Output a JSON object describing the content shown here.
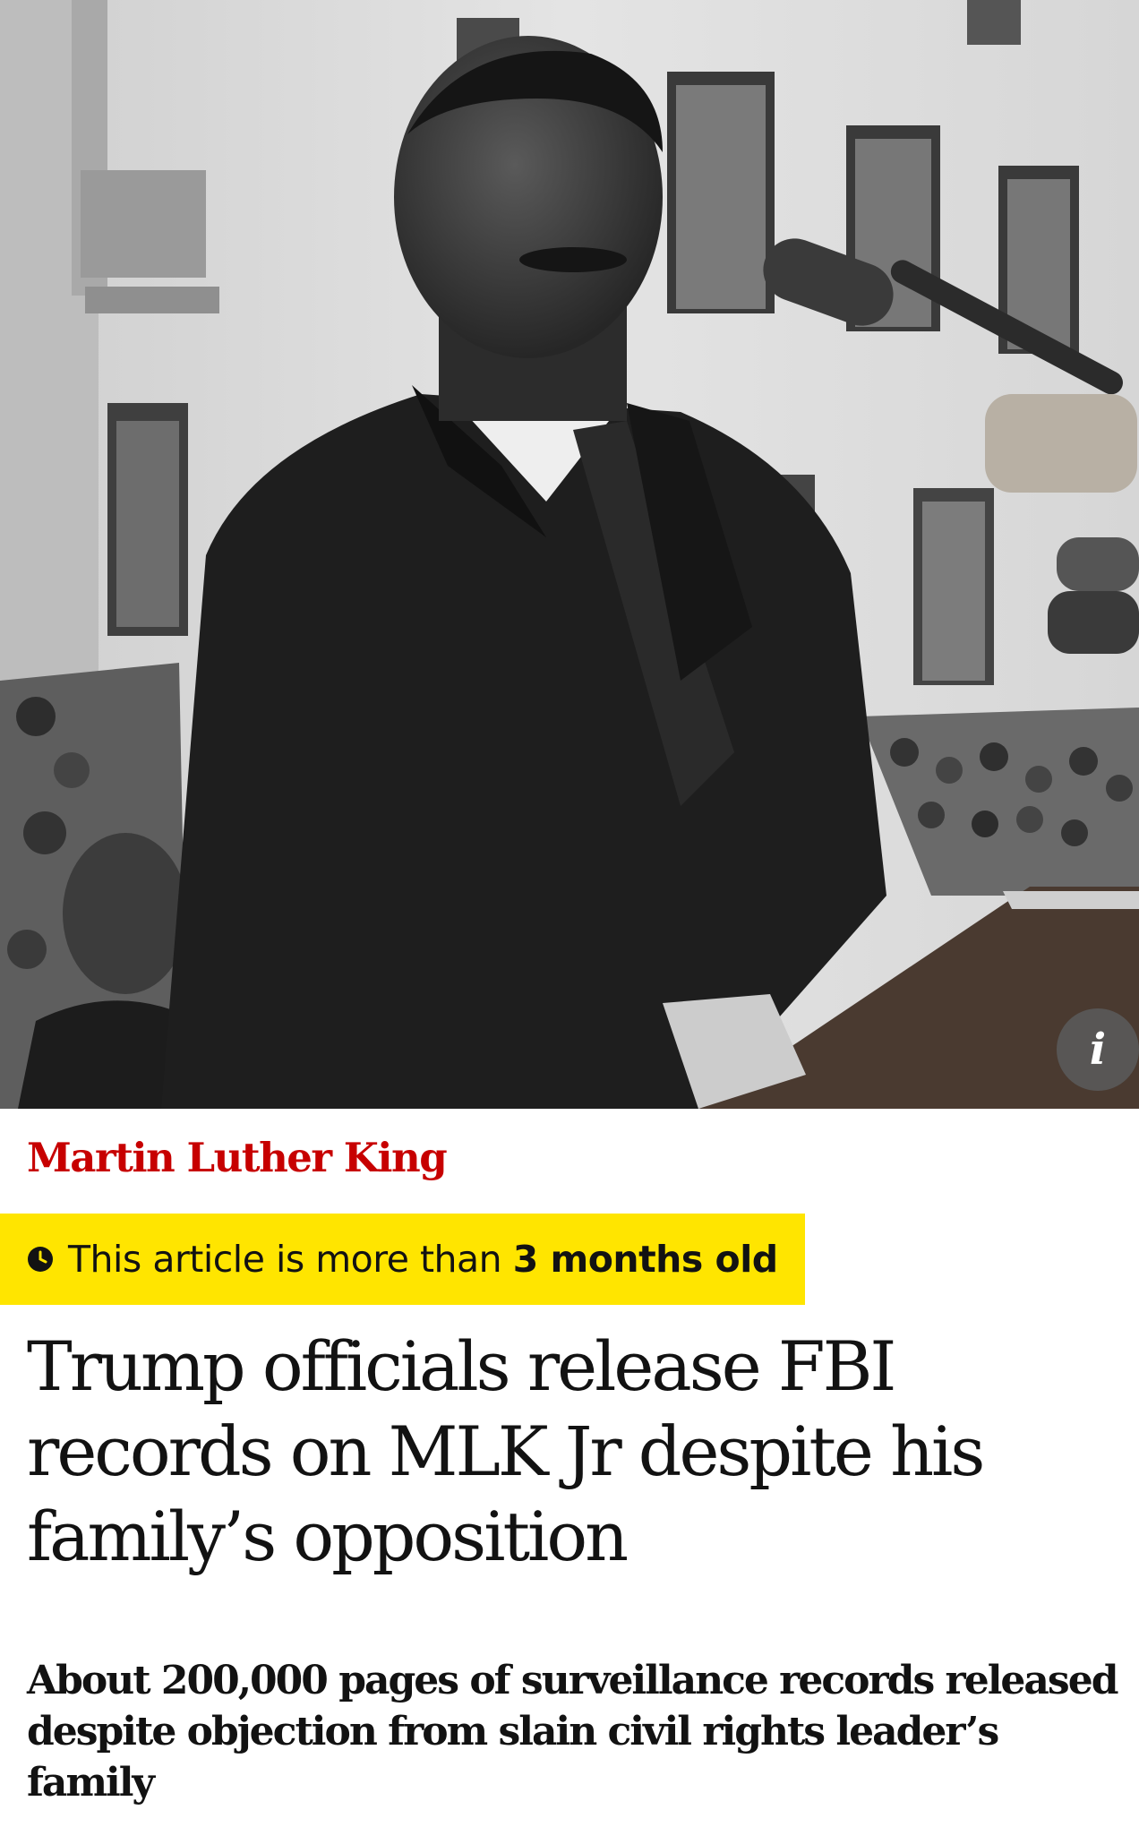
{
  "hero_image": {
    "alt": "Black-and-white photograph of Martin Luther King Jr speaking at a podium with microphones, a crowd and building behind him",
    "info_icon": "info-icon",
    "info_label": "i"
  },
  "section": {
    "label": "Martin Luther King",
    "color": "#c70000"
  },
  "age_warning": {
    "icon": "clock-icon",
    "prefix": "This article is more than ",
    "emphasis": "3 months old",
    "background": "#ffe500"
  },
  "headline": "Trump officials release FBI records on MLK Jr despite his family’s opposition",
  "standfirst": "About 200,000 pages of surveillance records released despite objection from slain civil rights leader’s family"
}
